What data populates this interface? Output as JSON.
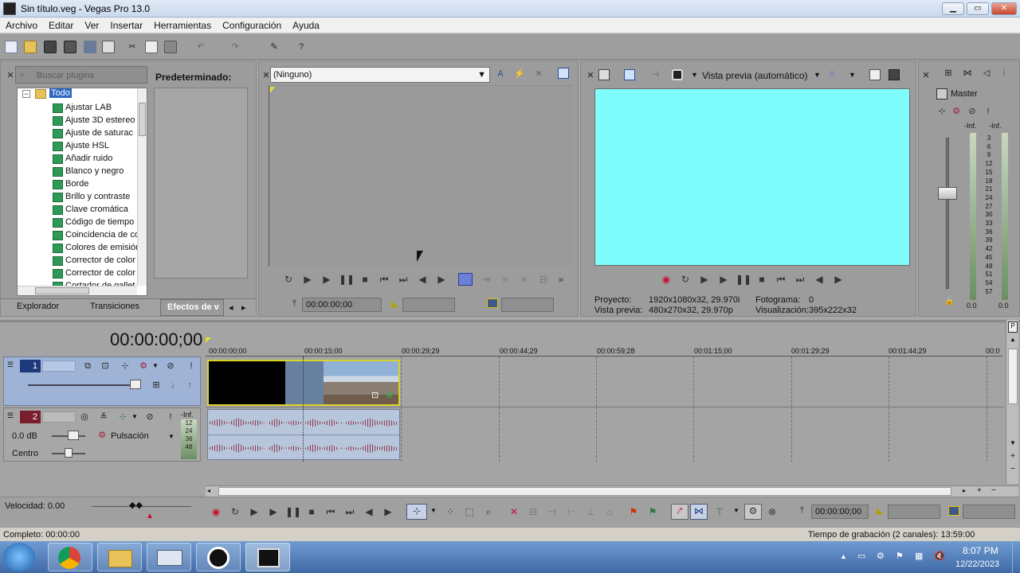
{
  "window": {
    "title": "Sin título.veg - Vegas Pro 13.0",
    "min": "▁",
    "max": "▭",
    "close": "✕"
  },
  "menu": [
    "Archivo",
    "Editar",
    "Ver",
    "Insertar",
    "Herramientas",
    "Configuración",
    "Ayuda"
  ],
  "plugins": {
    "search_placeholder": "Buscar plugins",
    "preset_header": "Predeterminado:",
    "root": "Todo",
    "items": [
      "Ajustar LAB",
      "Ajuste 3D estereo",
      "Ajuste de saturac",
      "Ajuste HSL",
      "Añadir ruido",
      "Blanco y negro",
      "Borde",
      "Brillo y contraste",
      "Clave cromática",
      "Código de tiempo",
      "Coincidencia de co",
      "Colores de emisión",
      "Corrector de color",
      "Corrector de color",
      "Cortador de gallet"
    ],
    "tabs": [
      "Explorador",
      "Transiciones",
      "Efectos de v"
    ]
  },
  "trimmer": {
    "dropdown": "(Ninguno)",
    "timecode": "00:00:00;00"
  },
  "preview": {
    "mode": "Vista previa (automático)",
    "screen_color": "#7ffcfc",
    "proyecto_label": "Proyecto:",
    "proyecto_value": "1920x1080x32, 29.970i",
    "vista_label": "Vista previa:",
    "vista_value": "480x270x32, 29.970p",
    "fotograma_label": "Fotograma:",
    "fotograma_value": "0",
    "visualizacion_label": "Visualización:",
    "visualizacion_value": "395x222x32"
  },
  "mixer": {
    "master": "Master",
    "inf_left": "-Inf.",
    "inf_right": "-Inf.",
    "scale": [
      "3",
      "6",
      "9",
      "12",
      "15",
      "18",
      "21",
      "24",
      "27",
      "30",
      "33",
      "36",
      "39",
      "42",
      "45",
      "48",
      "51",
      "54",
      "57"
    ],
    "bottom_left": "0.0",
    "bottom_right": "0.0"
  },
  "timeline": {
    "timecode": "00:00:00;00",
    "ruler": [
      "00:00:00;00",
      "00:00:15;00",
      "00:00:29;29",
      "00:00:44;29",
      "00:00:59;28",
      "00:01:15;00",
      "00:01:29;29",
      "00:01:44;29",
      "00:0"
    ],
    "track1_num": "1",
    "track2_num": "2",
    "track2_vol": "0.0 dB",
    "track2_pan": "Centro",
    "track2_mode": "Pulsación",
    "track2_inf": "-Inf.",
    "track2_meter": [
      "12",
      "24",
      "36",
      "48"
    ],
    "speed": "Velocidad: 0.00",
    "transport_timecode": "00:00:00;00"
  },
  "status": {
    "left": "Completo: 00:00:00",
    "right": "Tiempo de grabación (2 canales): 13:59:00"
  },
  "taskbar": {
    "time": "8:07 PM",
    "date": "12/22/2023"
  }
}
